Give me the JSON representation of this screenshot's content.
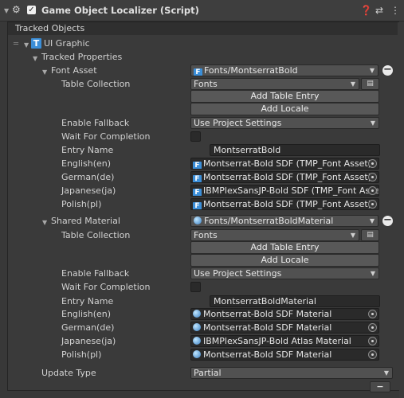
{
  "header": {
    "title": "Game Object Localizer (Script)"
  },
  "tracked_objects_label": "Tracked Objects",
  "ui_graphic_label": "UI Graphic",
  "tracked_properties_label": "Tracked Properties",
  "font_section": {
    "label": "Font Asset",
    "value": "Fonts/MontserratBold",
    "table_collection_label": "Table Collection",
    "table_collection_value": "Fonts",
    "add_table_entry": "Add Table Entry",
    "add_locale": "Add Locale",
    "enable_fallback_label": "Enable Fallback",
    "enable_fallback_value": "Use Project Settings",
    "wait_label": "Wait For Completion",
    "entry_name_label": "Entry Name",
    "entry_name_value": "MontserratBold",
    "locales": [
      {
        "label": "English(en)",
        "value": "Montserrat-Bold SDF (TMP_Font Asset)"
      },
      {
        "label": "German(de)",
        "value": "Montserrat-Bold SDF (TMP_Font Asset)"
      },
      {
        "label": "Japanese(ja)",
        "value": "IBMPlexSansJP-Bold SDF (TMP_Font Asset"
      },
      {
        "label": "Polish(pl)",
        "value": "Montserrat-Bold SDF (TMP_Font Asset)"
      }
    ]
  },
  "material_section": {
    "label": "Shared Material",
    "value": "Fonts/MontserratBoldMaterial",
    "table_collection_label": "Table Collection",
    "table_collection_value": "Fonts",
    "add_table_entry": "Add Table Entry",
    "add_locale": "Add Locale",
    "enable_fallback_label": "Enable Fallback",
    "enable_fallback_value": "Use Project Settings",
    "wait_label": "Wait For Completion",
    "entry_name_label": "Entry Name",
    "entry_name_value": "MontserratBoldMaterial",
    "locales": [
      {
        "label": "English(en)",
        "value": "Montserrat-Bold SDF Material"
      },
      {
        "label": "German(de)",
        "value": "Montserrat-Bold SDF Material"
      },
      {
        "label": "Japanese(ja)",
        "value": "IBMPlexSansJP-Bold Atlas Material"
      },
      {
        "label": "Polish(pl)",
        "value": "Montserrat-Bold SDF Material"
      }
    ]
  },
  "update_type_label": "Update Type",
  "update_type_value": "Partial",
  "footer_button": "−",
  "icons": {
    "font_icon": "F",
    "text_component_icon": "T",
    "minus": "−"
  },
  "colors": {
    "background": "#383838",
    "field": "#2a2a2a",
    "dropdown": "#515151",
    "accent": "#3b8ed8"
  }
}
